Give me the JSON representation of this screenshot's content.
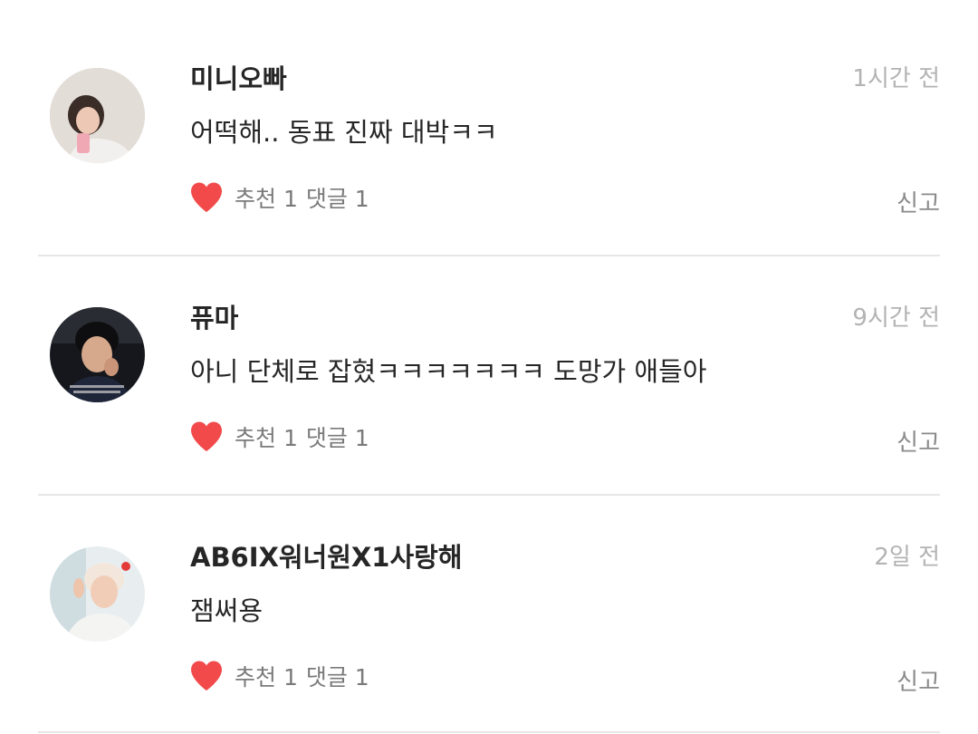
{
  "comments": [
    {
      "author": "미니오빠",
      "time": "1시간 전",
      "text": "어떡해.. 동표 진짜 대박ㅋㅋ",
      "likes_label": "추천 1",
      "replies_label": "댓글 1",
      "report_label": "신고",
      "like_icon": "heart-icon",
      "like_color": "#f24a4a"
    },
    {
      "author": "퓨마",
      "time": "9시간 전",
      "text": "아니 단체로 잡혔ㅋㅋㅋㅋㅋㅋㅋ 도망가 애들아",
      "likes_label": "추천 1",
      "replies_label": "댓글 1",
      "report_label": "신고",
      "like_icon": "heart-icon",
      "like_color": "#f24a4a"
    },
    {
      "author": "AB6IX워너원X1사랑해",
      "time": "2일 전",
      "text": "잼써용",
      "likes_label": "추천 1",
      "replies_label": "댓글 1",
      "report_label": "신고",
      "like_icon": "heart-icon",
      "like_color": "#f24a4a"
    }
  ]
}
